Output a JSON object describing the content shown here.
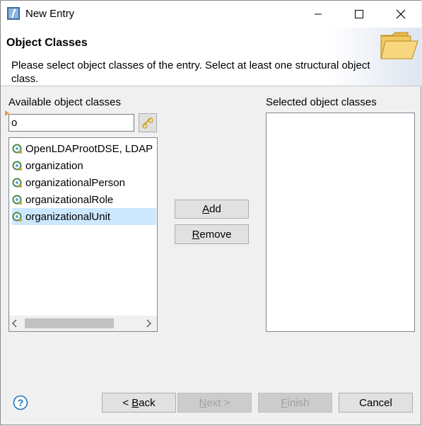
{
  "window": {
    "title": "New Entry",
    "controls": [
      "minimize",
      "maximize",
      "close"
    ]
  },
  "header": {
    "title": "Object Classes",
    "description": "Please select object classes of the entry. Select at least one structural object class."
  },
  "available": {
    "label": "Available object classes",
    "filter_value": "o",
    "items": [
      {
        "label": "OpenLDAProotDSE, LDAP",
        "selected": false
      },
      {
        "label": "organization",
        "selected": false
      },
      {
        "label": "organizationalPerson",
        "selected": false
      },
      {
        "label": "organizationalRole",
        "selected": false
      },
      {
        "label": "organizationalUnit",
        "selected": true
      }
    ]
  },
  "actions": {
    "add_label": "Add",
    "add_rest": "dd",
    "add_mnemonic": "A",
    "remove_mnemonic": "R",
    "remove_rest": "emove"
  },
  "selected": {
    "label": "Selected object classes",
    "items": []
  },
  "footer": {
    "back_mnemonic": "B",
    "back_prefix": "< ",
    "back_rest": "ack",
    "next_mnemonic": "N",
    "next_rest": "ext >",
    "finish_mnemonic": "F",
    "finish_rest": "inish",
    "cancel_label": "Cancel"
  },
  "colors": {
    "selection": "#cce8ff",
    "help_icon": "#1e73be"
  }
}
